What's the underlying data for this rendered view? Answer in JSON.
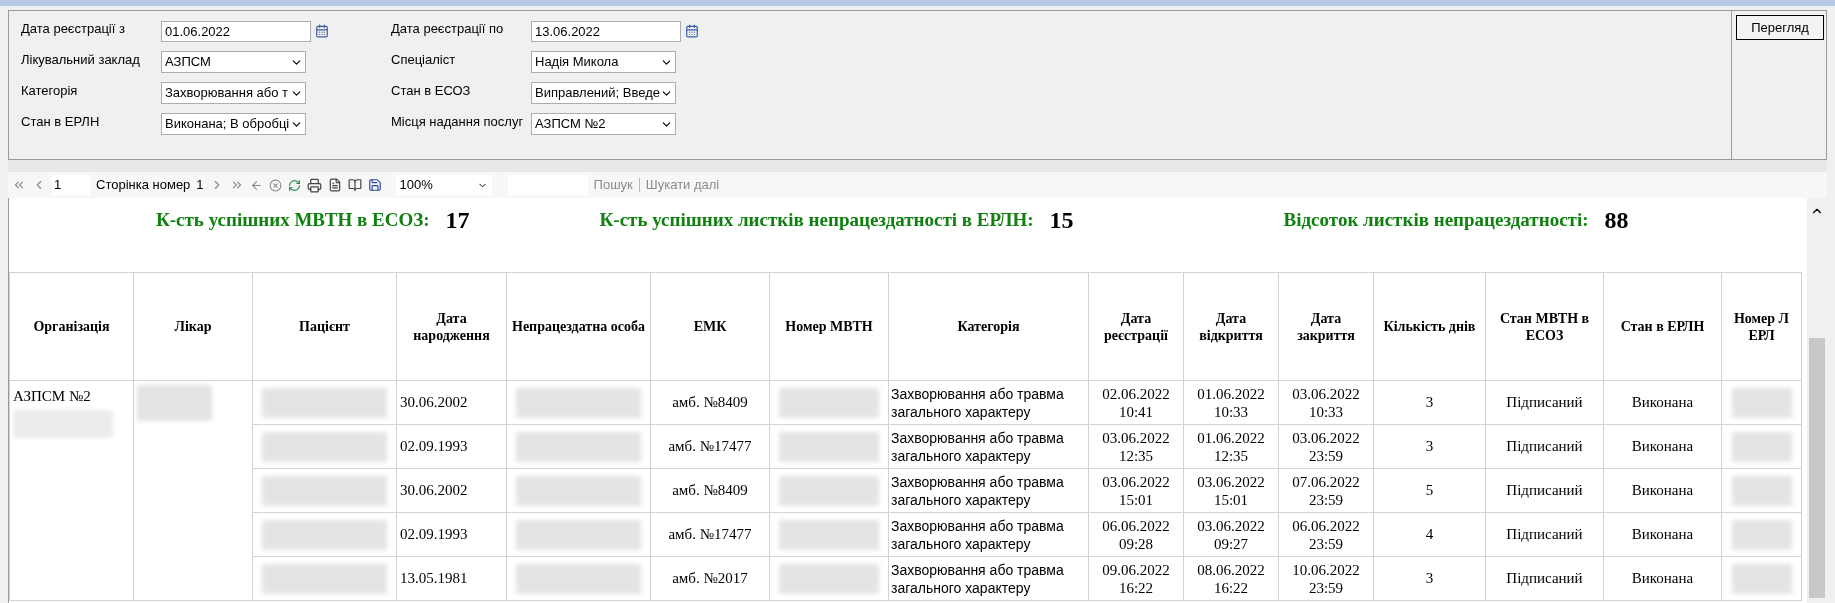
{
  "filters": {
    "left": [
      {
        "kind": "date",
        "label": "Дата  реєстрації з",
        "value": "01.06.2022"
      },
      {
        "kind": "combo",
        "label": "Лікувальний заклад",
        "value": "АЗПСМ"
      },
      {
        "kind": "combo",
        "label": "Категорія",
        "value": "Захворювання або т"
      },
      {
        "kind": "combo",
        "label": "Стан в ЕРЛН",
        "value": "Виконана; В обробці"
      }
    ],
    "right": [
      {
        "kind": "date",
        "label": "Дата  реєстрації по",
        "value": "13.06.2022"
      },
      {
        "kind": "combo",
        "label": "Спеціаліст",
        "value": "Надія Микола"
      },
      {
        "kind": "combo",
        "label": "Стан в ЕСОЗ",
        "value": "Виправлений; Введе"
      },
      {
        "kind": "combo",
        "label": "Місця надання послуг",
        "value": "АЗПСМ №2"
      }
    ],
    "view_button": "Перегляд"
  },
  "toolbar": {
    "page_input": "1",
    "page_label": "Сторінка номер",
    "page_count": "1",
    "zoom": "100%",
    "search": "Пошук",
    "find_next": "Шукати далі"
  },
  "summary": [
    {
      "label": "К-сть успішних МВТН  в ЕСОЗ:",
      "value": "17"
    },
    {
      "label": "К-сть успішних листків непрацездатності в ЕРЛН:",
      "value": "15"
    },
    {
      "label": "Відсоток листків непрацездатності:",
      "value": "88"
    }
  ],
  "table": {
    "columns": [
      "Організація",
      "Лікар",
      "Пацієнт",
      "Дата народження",
      "Непрацездатна особа",
      "ЕМК",
      "Номер МВТН",
      "Категорія",
      "Дата реєстрації",
      "Дата відкриття",
      "Дата закриття",
      "Кількість днів",
      "Стан МВТН в ЕСОЗ",
      "Стан в ЕРЛН",
      "Номер Л ЕРЛ"
    ],
    "organization": "АЗПСМ №2",
    "rows": [
      {
        "birth": "30.06.2002",
        "emk": "амб. №8409",
        "category": "Захворювання або травма загального характеру",
        "registered": [
          "02.06.2022",
          "10:41"
        ],
        "opened": [
          "01.06.2022",
          "10:33"
        ],
        "closed": [
          "03.06.2022",
          "10:33"
        ],
        "days": "3",
        "esoz_state": "Підписаний",
        "erln_state": "Виконана"
      },
      {
        "birth": "02.09.1993",
        "emk": "амб. №17477",
        "category": "Захворювання або травма загального характеру",
        "registered": [
          "03.06.2022",
          "12:35"
        ],
        "opened": [
          "01.06.2022",
          "12:35"
        ],
        "closed": [
          "03.06.2022",
          "23:59"
        ],
        "days": "3",
        "esoz_state": "Підписаний",
        "erln_state": "Виконана"
      },
      {
        "birth": "30.06.2002",
        "emk": "амб. №8409",
        "category": "Захворювання або травма загального характеру",
        "registered": [
          "03.06.2022",
          "15:01"
        ],
        "opened": [
          "03.06.2022",
          "15:01"
        ],
        "closed": [
          "07.06.2022",
          "23:59"
        ],
        "days": "5",
        "esoz_state": "Підписаний",
        "erln_state": "Виконана"
      },
      {
        "birth": "02.09.1993",
        "emk": "амб. №17477",
        "category": "Захворювання або травма загального характеру",
        "registered": [
          "06.06.2022",
          "09:28"
        ],
        "opened": [
          "03.06.2022",
          "09:27"
        ],
        "closed": [
          "06.06.2022",
          "23:59"
        ],
        "days": "4",
        "esoz_state": "Підписаний",
        "erln_state": "Виконана"
      },
      {
        "birth": "13.05.1981",
        "emk": "амб. №2017",
        "category": "Захворювання або травма загального характеру",
        "registered": [
          "09.06.2022",
          "16:22"
        ],
        "opened": [
          "08.06.2022",
          "16:22"
        ],
        "closed": [
          "10.06.2022",
          "23:59"
        ],
        "days": "3",
        "esoz_state": "Підписаний",
        "erln_state": "Виконана"
      }
    ]
  }
}
